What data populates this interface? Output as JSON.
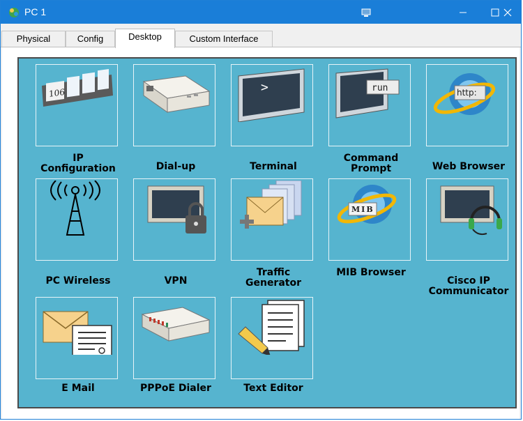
{
  "window": {
    "title": "PC 1"
  },
  "tabs": [
    {
      "label": "Physical"
    },
    {
      "label": "Config"
    },
    {
      "label": "Desktop"
    },
    {
      "label": "Custom Interface"
    }
  ],
  "active_tab": "Desktop",
  "apps": [
    {
      "label": "IP\nConfiguration",
      "icon": "ip-config-icon",
      "icon_text": "106"
    },
    {
      "label": "Dial-up",
      "icon": "modem-icon"
    },
    {
      "label": "Terminal",
      "icon": "terminal-icon",
      "icon_text": ">"
    },
    {
      "label": "Command\nPrompt",
      "icon": "command-prompt-icon",
      "icon_text": "run"
    },
    {
      "label": "Web Browser",
      "icon": "web-browser-icon",
      "icon_text": "http:"
    },
    {
      "label": "PC Wireless",
      "icon": "wireless-tower-icon"
    },
    {
      "label": "VPN",
      "icon": "vpn-lock-icon"
    },
    {
      "label": "Traffic\nGenerator",
      "icon": "traffic-generator-icon"
    },
    {
      "label": "MIB Browser",
      "icon": "mib-browser-icon",
      "icon_text": "MIB"
    },
    {
      "label": "Cisco IP\nCommunicator",
      "icon": "headset-monitor-icon"
    },
    {
      "label": "E Mail",
      "icon": "email-icon"
    },
    {
      "label": "PPPoE Dialer",
      "icon": "pppoe-dialer-icon"
    },
    {
      "label": "Text Editor",
      "icon": "text-editor-icon"
    }
  ],
  "colors": {
    "titlebar": "#1a7ed8",
    "desktop": "#56b4cf"
  }
}
